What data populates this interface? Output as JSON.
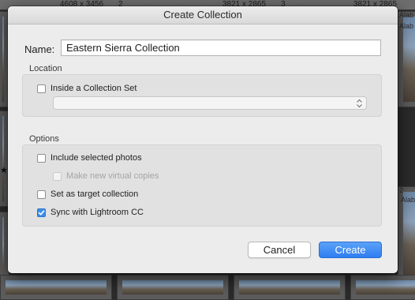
{
  "background": {
    "top_strip": [
      "4608 x 3456",
      "2",
      "3821 x 2865",
      "3",
      "3821 x 2865"
    ],
    "side_labels": [
      "Alab",
      "Alab",
      "Alab"
    ],
    "right_count": "2",
    "star": "★"
  },
  "dialog": {
    "title": "Create Collection",
    "name_label": "Name:",
    "name_value": "Eastern Sierra Collection",
    "location": {
      "title": "Location",
      "inside_set_label": "Inside a Collection Set",
      "inside_set_checked": false,
      "set_select_value": ""
    },
    "options": {
      "title": "Options",
      "include_selected": {
        "label": "Include selected photos",
        "checked": false
      },
      "virtual_copies": {
        "label": "Make new virtual copies",
        "checked": false,
        "disabled": true
      },
      "target_collection": {
        "label": "Set as target collection",
        "checked": false
      },
      "sync_lightroom": {
        "label": "Sync with Lightroom CC",
        "checked": true
      }
    },
    "buttons": {
      "cancel": "Cancel",
      "create": "Create"
    },
    "colors": {
      "accent": "#3d8de8",
      "dialog_bg": "#ececec"
    }
  }
}
